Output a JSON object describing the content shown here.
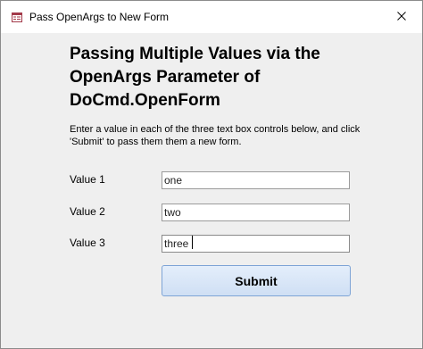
{
  "window": {
    "title": "Pass OpenArgs to New Form",
    "icons": {
      "app": "form-icon",
      "close": "close-icon"
    }
  },
  "form": {
    "heading": "Passing Multiple Values via the OpenArgs Parameter of DoCmd.OpenForm",
    "instructions": "Enter a value in each of the three text box controls below, and click 'Submit' to pass them them a new form.",
    "fields": [
      {
        "label": "Value 1",
        "value": "one"
      },
      {
        "label": "Value 2",
        "value": "two"
      },
      {
        "label": "Value 3",
        "value": "three"
      }
    ],
    "submit_label": "Submit"
  },
  "colors": {
    "form_background": "#efefef",
    "button_border": "#7ea4d6",
    "button_fill": "#d8e6f8"
  }
}
